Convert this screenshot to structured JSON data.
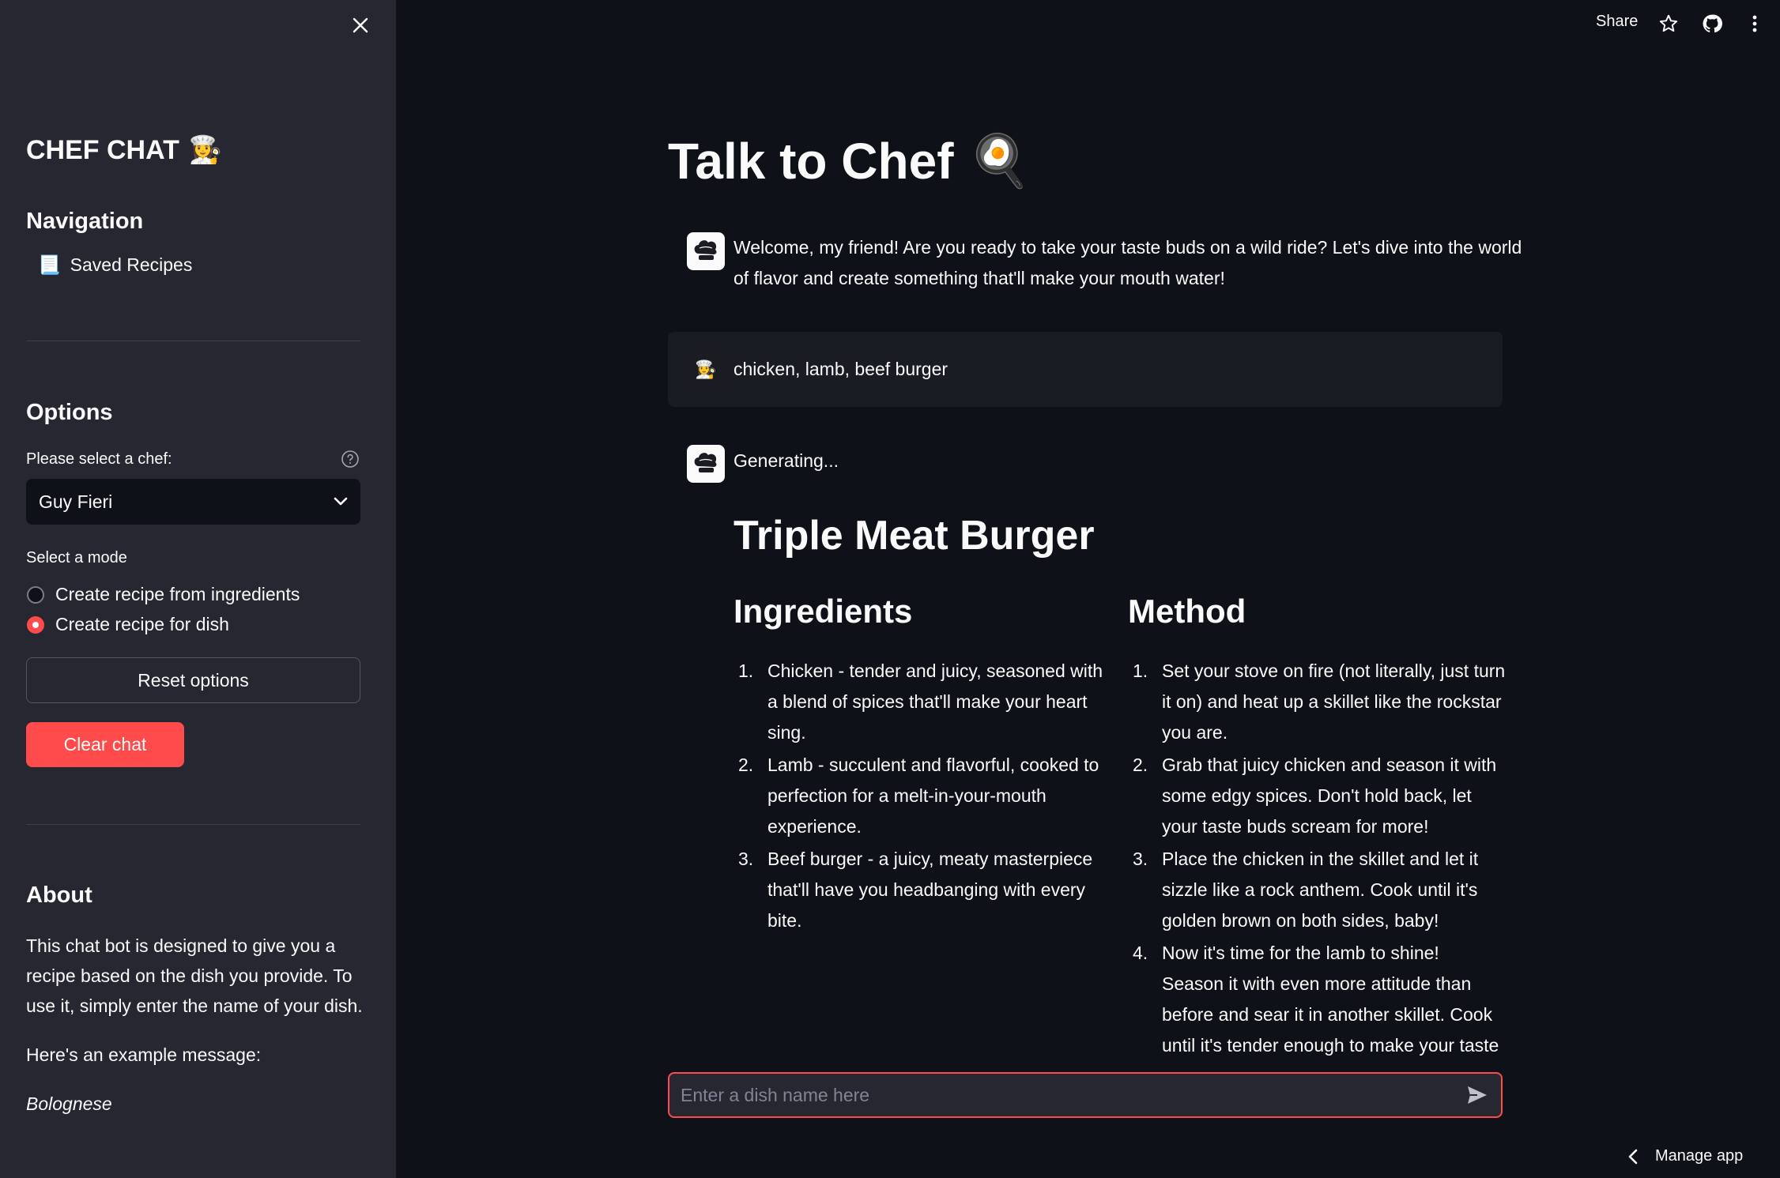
{
  "sidebar": {
    "title": "CHEF CHAT",
    "title_emoji": "👩‍🍳",
    "navigation_heading": "Navigation",
    "nav_items": [
      {
        "label": "Saved Recipes",
        "icon": "📃"
      }
    ],
    "options_heading": "Options",
    "chef_label": "Please select a chef:",
    "chef_selected": "Guy Fieri",
    "mode_label": "Select a mode",
    "modes": [
      {
        "label": "Create recipe from ingredients",
        "selected": false
      },
      {
        "label": "Create recipe for dish",
        "selected": true
      }
    ],
    "reset_label": "Reset options",
    "clear_label": "Clear chat",
    "about_heading": "About",
    "about_text": "This chat bot is designed to give you a recipe based on the dish you provide. To use it, simply enter the name of your dish.",
    "example_intro": "Here's an example message:",
    "example": "Bolognese"
  },
  "header": {
    "share_label": "Share",
    "icons": [
      "star-icon",
      "github-icon",
      "more-vertical-icon"
    ]
  },
  "main": {
    "title": "Talk to Chef",
    "title_emoji": "🍳",
    "messages": [
      {
        "role": "assistant",
        "text_line1": "Welcome, my friend! Are you ready to take your taste buds on a wild ride? Let's dive into the world",
        "text_line2": "of flavor and create something that'll make your mouth water!"
      },
      {
        "role": "user",
        "text": "chicken, lamb, beef burger"
      },
      {
        "role": "assistant",
        "text": "Generating..."
      }
    ],
    "recipe": {
      "title": "Triple Meat Burger",
      "ingredients_heading": "Ingredients",
      "method_heading": "Method",
      "ingredients": [
        "Chicken - tender and juicy, seasoned with a blend of spices that'll make your heart sing.",
        "Lamb - succulent and flavorful, cooked to perfection for a melt-in-your-mouth experience.",
        "Beef burger - a juicy, meaty masterpiece that'll have you headbanging with every bite."
      ],
      "method": [
        "Set your stove on fire (not literally, just turn it on) and heat up a skillet like the rockstar you are.",
        "Grab that juicy chicken and season it with some edgy spices. Don't hold back, let your taste buds scream for more!",
        "Place the chicken in the skillet and let it sizzle like a rock anthem. Cook until it's golden brown on both sides, baby!",
        "Now it's time for the lamb to shine! Season it with even more attitude than before and sear it in another skillet. Cook until it's tender enough to make your taste buds"
      ]
    },
    "input_placeholder": "Enter a dish name here",
    "manage_label": "Manage app"
  }
}
